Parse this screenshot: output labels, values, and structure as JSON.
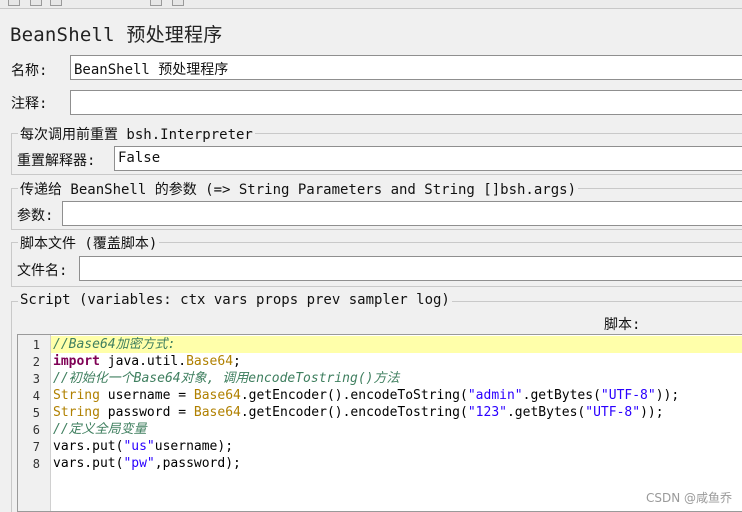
{
  "panel": {
    "title": "BeanShell 预处理程序"
  },
  "name_field": {
    "label": "名称:",
    "value": "BeanShell 预处理程序"
  },
  "comment_field": {
    "label": "注释:",
    "value": ""
  },
  "reset_group": {
    "legend": "每次调用前重置 bsh.Interpreter",
    "label": "重置解释器:",
    "value": "False"
  },
  "params_group": {
    "legend": "传递给 BeanShell 的参数 (=> String Parameters and String []bsh.args)",
    "label": "参数:",
    "value": ""
  },
  "script_file_group": {
    "legend": "脚本文件 (覆盖脚本)",
    "label": "文件名:",
    "value": ""
  },
  "script_group": {
    "legend": "Script (variables: ctx vars props prev sampler log)",
    "script_label": "脚本:"
  },
  "editor": {
    "line_numbers": [
      "1",
      "2",
      "3",
      "4",
      "5",
      "6",
      "7",
      "8"
    ],
    "lines": [
      "//Base64加密方式:",
      "import java.util.Base64;",
      "//初始化一个Base64对象, 调用encodeTostring()方法",
      "String username = Base64.getEncoder().encodeToString(\"admin\".getBytes(\"UTF-8\"));",
      "String password = Base64.getEncoder().encodeTostring(\"123\".getBytes(\"UTF-8\"));",
      "//定义全局变量",
      "vars.put(\"us\"username);",
      "vars.put(\"pw\",password);"
    ]
  },
  "watermark": "CSDN @咸鱼乔"
}
